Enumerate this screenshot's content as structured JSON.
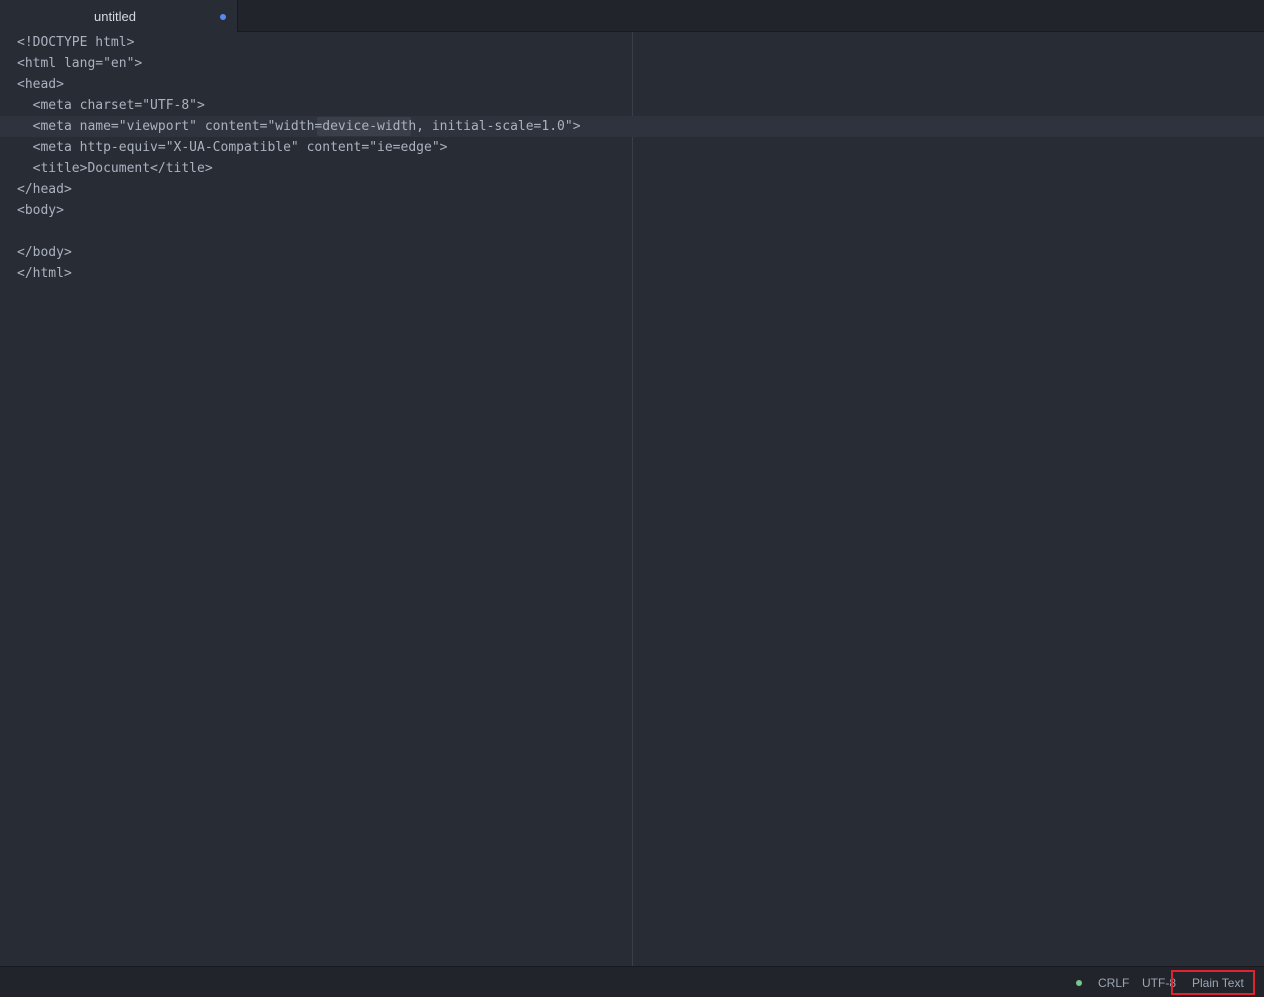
{
  "tab": {
    "title": "untitled"
  },
  "editor": {
    "lines": [
      "<!DOCTYPE html>",
      "<html lang=\"en\">",
      "<head>",
      "  <meta charset=\"UTF-8\">",
      "  <meta name=\"viewport\" content=\"width=device-width, initial-scale=1.0\">",
      "  <meta http-equiv=\"X-UA-Compatible\" content=\"ie=edge\">",
      "  <title>Document</title>",
      "</head>",
      "<body>",
      "",
      "</body>",
      "</html>"
    ],
    "cursor_line_number": 5,
    "highlighted_word": "device-width"
  },
  "statusbar": {
    "line_ending": "CRLF",
    "encoding": "UTF-8",
    "grammar": "Plain Text"
  },
  "colors": {
    "background": "#282c34",
    "tabbar": "#21252b",
    "text": "#abb2bf",
    "modified_dot": "#568af2",
    "status_dot": "#73c990",
    "highlight_box": "#e0232e"
  }
}
